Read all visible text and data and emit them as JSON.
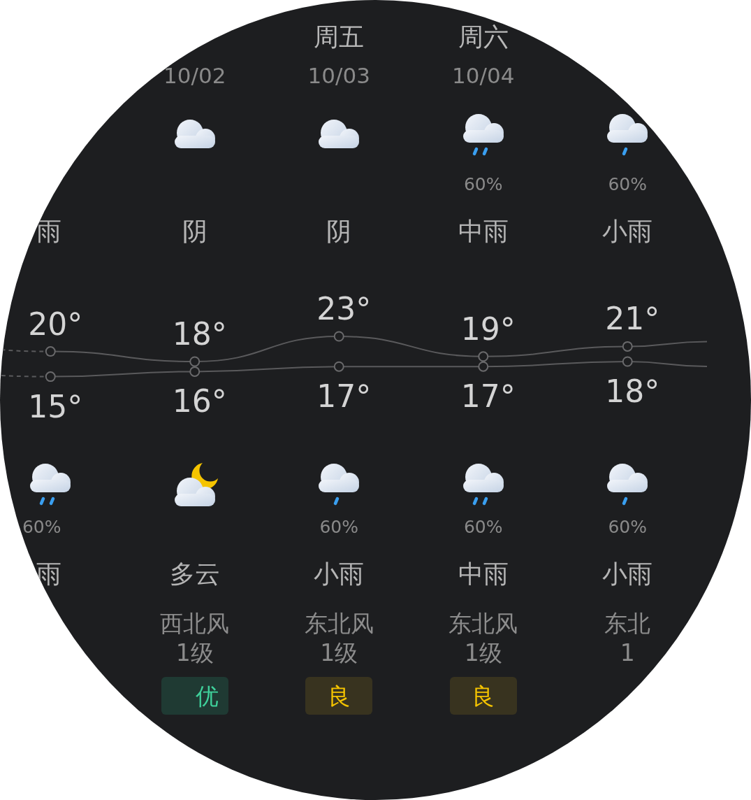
{
  "days": [
    {
      "day": {
        "weather": "雨"
      },
      "high": "20°",
      "low": "15°",
      "night": {
        "icon": {
          "kind": "showers"
        },
        "precip": "60%",
        "weather": "雨"
      }
    },
    {
      "date": "10/02",
      "day": {
        "icon": {
          "kind": "overcast"
        },
        "weather": "阴"
      },
      "high": "18°",
      "low": "16°",
      "night": {
        "icon": {
          "kind": "nightcloud"
        },
        "weather": "多云"
      },
      "wind": [
        "西北风",
        "1级"
      ],
      "aqi": {
        "label": "优",
        "kind": "excellent"
      }
    },
    {
      "weekday": "周五",
      "date": "10/03",
      "day": {
        "icon": {
          "kind": "overcast"
        },
        "weather": "阴"
      },
      "high": "23°",
      "low": "17°",
      "night": {
        "icon": {
          "kind": "drizzle"
        },
        "precip": "60%",
        "weather": "小雨"
      },
      "wind": [
        "东北风",
        "1级"
      ],
      "aqi": {
        "label": "良",
        "kind": "good"
      }
    },
    {
      "weekday": "周六",
      "date": "10/04",
      "day": {
        "icon": {
          "kind": "showers"
        },
        "precip": "60%",
        "weather": "中雨"
      },
      "high": "19°",
      "low": "17°",
      "night": {
        "icon": {
          "kind": "showers"
        },
        "precip": "60%",
        "weather": "中雨"
      },
      "wind": [
        "东北风",
        "1级"
      ],
      "aqi": {
        "label": "良",
        "kind": "good"
      }
    },
    {
      "day": {
        "icon": {
          "kind": "drizzle"
        },
        "precip": "60%",
        "weather": "小雨"
      },
      "high": "21°",
      "low": "18°",
      "night": {
        "icon": {
          "kind": "drizzle"
        },
        "precip": "60%",
        "weather": "小雨"
      },
      "wind": [
        "东北",
        "1"
      ]
    }
  ]
}
